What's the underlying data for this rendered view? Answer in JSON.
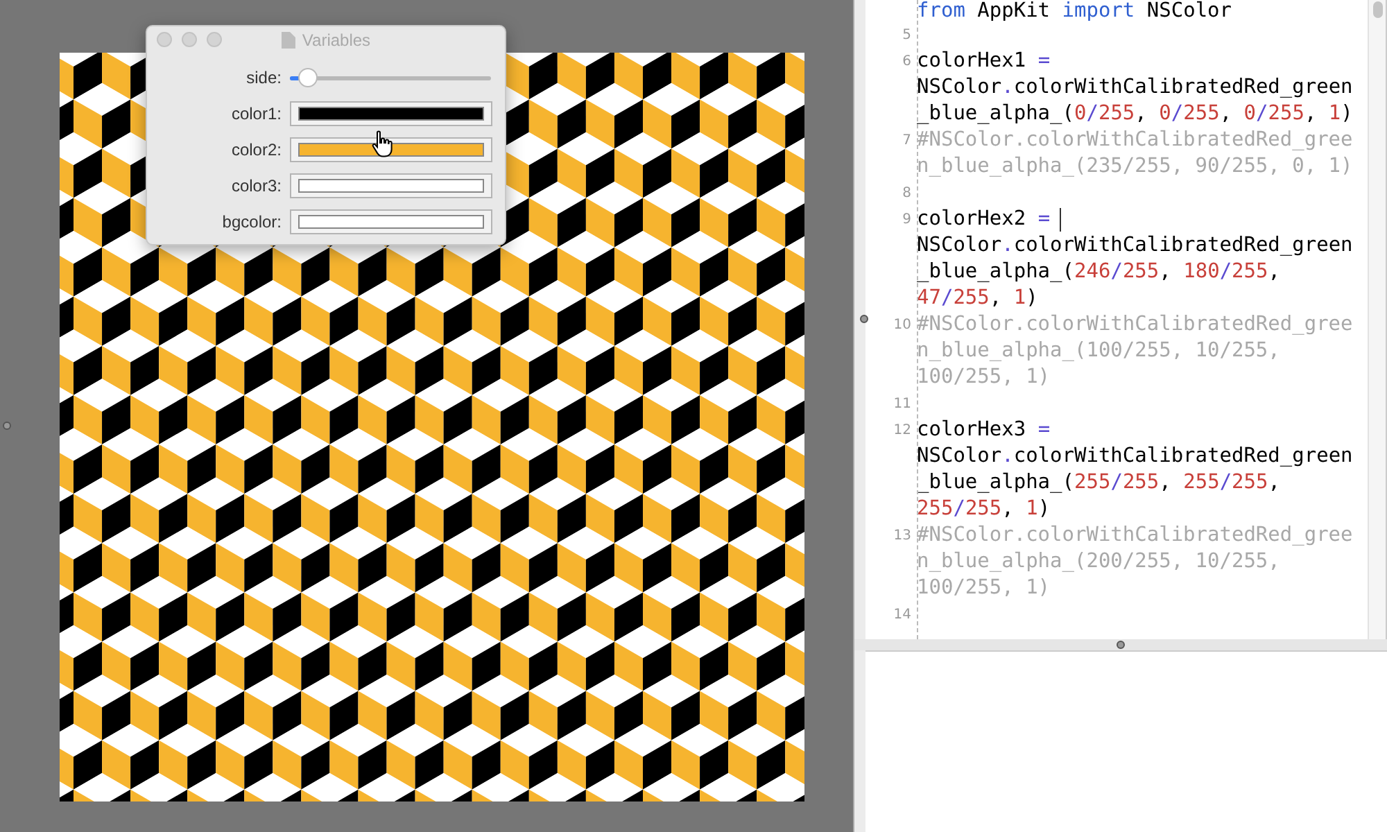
{
  "variables_window": {
    "title": "Variables",
    "controls": [
      {
        "kind": "slider",
        "label": "side:",
        "level": 0.05
      },
      {
        "kind": "color",
        "label": "color1:",
        "color": "#000000"
      },
      {
        "kind": "color",
        "label": "color2:",
        "color": "#f6b42f"
      },
      {
        "kind": "color",
        "label": "color3:",
        "color": "#ffffff"
      },
      {
        "kind": "color",
        "label": "bgcolor:",
        "color": "#ffffff"
      }
    ]
  },
  "editor": {
    "lines": [
      {
        "kind": "import",
        "cursor": false,
        "rows": [
          "from AppKit import NSColor"
        ]
      },
      {
        "number": "5",
        "kind": "blank",
        "cursor": false
      },
      {
        "number": "6",
        "kind": "code",
        "cursor": false,
        "rows": [
          "colorHex1 =",
          "NSColor.colorWithCalibratedRed_green",
          "_blue_alpha_(0/255, 0/255, 0/255, 1)"
        ]
      },
      {
        "number": "7",
        "kind": "comment",
        "cursor": false,
        "rows": [
          "#NSColor.colorWithCalibratedRed_gree",
          "n_blue_alpha_(235/255, 90/255, 0, 1)"
        ]
      },
      {
        "number": "8",
        "kind": "blank",
        "cursor": false
      },
      {
        "number": "9",
        "kind": "code",
        "cursor": true,
        "rows": [
          "colorHex2 =",
          "NSColor.colorWithCalibratedRed_green",
          "_blue_alpha_(246/255, 180/255,",
          "47/255, 1)"
        ]
      },
      {
        "number": "10",
        "kind": "comment",
        "cursor": false,
        "rows": [
          "#NSColor.colorWithCalibratedRed_gree",
          "n_blue_alpha_(100/255, 10/255,",
          "100/255, 1)"
        ]
      },
      {
        "number": "11",
        "kind": "blank",
        "cursor": false
      },
      {
        "number": "12",
        "kind": "code",
        "cursor": false,
        "rows": [
          "colorHex3 =",
          "NSColor.colorWithCalibratedRed_green",
          "_blue_alpha_(255/255, 255/255,",
          "255/255, 1)"
        ]
      },
      {
        "number": "13",
        "kind": "comment",
        "cursor": false,
        "rows": [
          "#NSColor.colorWithCalibratedRed_gree",
          "n_blue_alpha_(200/255, 10/255,",
          "100/255, 1)"
        ]
      },
      {
        "number": "14",
        "kind": "blank",
        "cursor": false
      }
    ]
  }
}
